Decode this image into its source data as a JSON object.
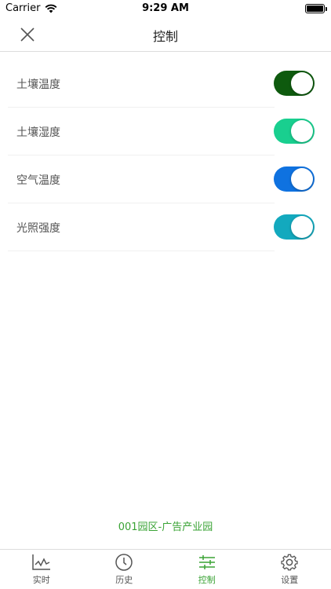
{
  "status": {
    "carrier": "Carrier",
    "time": "9:29 AM"
  },
  "nav": {
    "title": "控制"
  },
  "controls": [
    {
      "label": "土壤温度",
      "on": true,
      "color": "#0e5a0e"
    },
    {
      "label": "土壤湿度",
      "on": true,
      "color": "#19cf8f"
    },
    {
      "label": "空气温度",
      "on": true,
      "color": "#0f72e0"
    },
    {
      "label": "光照强度",
      "on": true,
      "color": "#13a9be"
    }
  ],
  "footer": {
    "caption": "001园区-广告产业园"
  },
  "tabs": [
    {
      "label": "实时",
      "icon": "chart-icon",
      "active": false
    },
    {
      "label": "历史",
      "icon": "clock-icon",
      "active": false
    },
    {
      "label": "控制",
      "icon": "sliders-icon",
      "active": true
    },
    {
      "label": "设置",
      "icon": "gear-icon",
      "active": false
    }
  ],
  "colors": {
    "accent": "#3aa335"
  }
}
